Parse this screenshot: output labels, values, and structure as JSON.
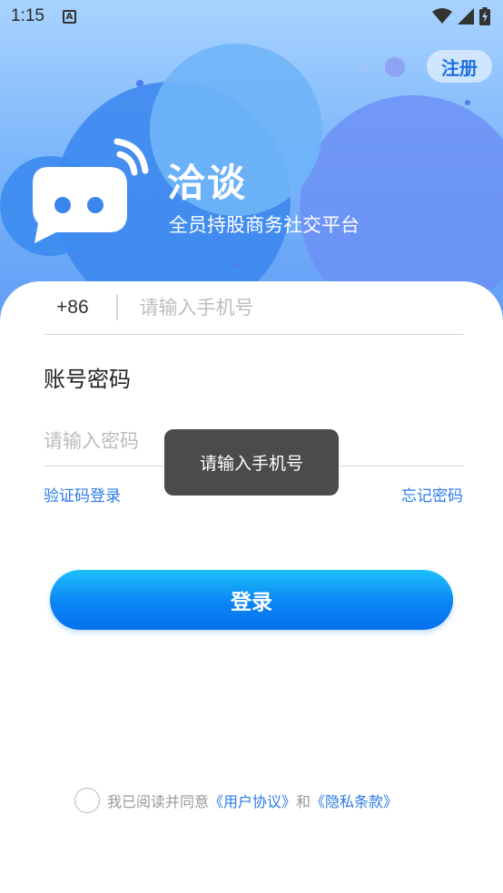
{
  "status_bar": {
    "time": "1:15",
    "notification_icon": "a-icon",
    "wifi_icon": "wifi-icon",
    "signal_icon": "signal-icon",
    "battery_icon": "battery-charging-icon"
  },
  "header": {
    "register_label": "注册",
    "brand_title": "洽谈",
    "brand_subtitle": "全员持股商务社交平台",
    "logo_icon": "chat-bubble-logo-icon"
  },
  "form": {
    "country_code": "+86",
    "phone_placeholder": "请输入手机号",
    "section_title": "账号密码",
    "password_placeholder": "请输入密码",
    "sms_login_label": "验证码登录",
    "forgot_password_label": "忘记密码",
    "login_label": "登录"
  },
  "agreement": {
    "prefix": "我已阅读并同意",
    "user_agreement": "《用户协议》",
    "and": "和",
    "privacy_policy": "《隐私条款》"
  },
  "toast": {
    "message": "请输入手机号"
  },
  "colors": {
    "accent": "#2b7ae6",
    "login_gradient_start": "#1dc0fb",
    "login_gradient_end": "#0872ee",
    "header_top": "#a9d3ff",
    "header_bottom": "#5f9cf5"
  }
}
